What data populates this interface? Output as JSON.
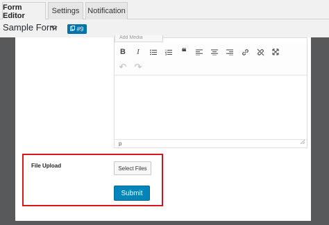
{
  "tabs": [
    {
      "label": "Form Editor",
      "active": true
    },
    {
      "label": "Settings",
      "active": false
    },
    {
      "label": "Notification",
      "active": false
    }
  ],
  "header": {
    "form_title": "Sample Form",
    "badge_label": "#9"
  },
  "editor": {
    "add_media_label": "Add Media",
    "toolbar": [
      {
        "icon": "bold-icon",
        "glyph": "B"
      },
      {
        "icon": "italic-icon",
        "glyph": "I"
      },
      {
        "icon": "bulleted-list-icon",
        "glyph": "≔"
      },
      {
        "icon": "numbered-list-icon",
        "glyph": "≡"
      },
      {
        "icon": "blockquote-icon",
        "glyph": "❝"
      },
      {
        "icon": "align-left-icon",
        "glyph": "≡"
      },
      {
        "icon": "align-center-icon",
        "glyph": "≡"
      },
      {
        "icon": "align-right-icon",
        "glyph": "≡"
      },
      {
        "icon": "link-icon",
        "glyph": "🔗"
      },
      {
        "icon": "unlink-icon",
        "glyph": "⛓"
      },
      {
        "icon": "fullscreen-icon",
        "glyph": "✕"
      }
    ],
    "toolbar_row2": [
      {
        "icon": "undo-icon",
        "glyph": "↶"
      },
      {
        "icon": "redo-icon",
        "glyph": "↷"
      }
    ],
    "status_path": "p"
  },
  "fields": {
    "file_upload_label": "File Upload",
    "select_files_label": "Select Files",
    "submit_label": "Submit"
  },
  "colors": {
    "accent": "#0085ba",
    "badge": "#0073aa",
    "highlight_border": "#d6141a",
    "canvas_frame": "#58595b"
  }
}
